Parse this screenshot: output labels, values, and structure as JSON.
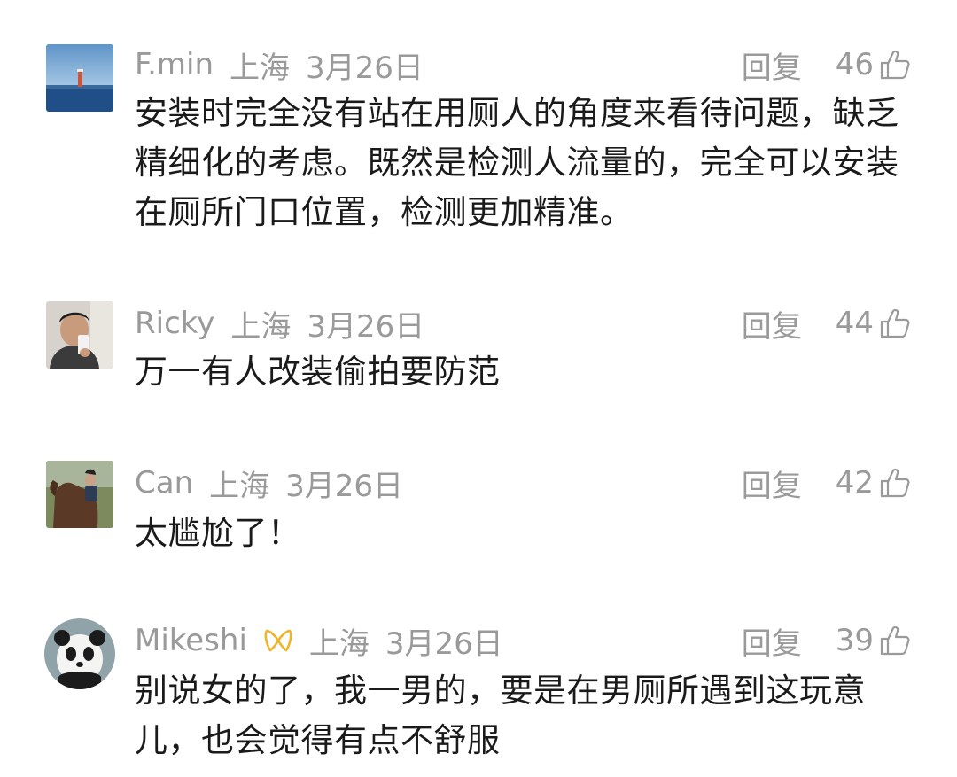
{
  "comments": [
    {
      "name": "F.min",
      "location": "上海",
      "date": "3月26日",
      "reply_label": "回复",
      "likes": "46",
      "text": "安装时完全没有站在用厕人的角度来看待问题，缺乏精细化的考虑。既然是检测人流量的，完全可以安装在厕所门口位置，检测更加精准。",
      "avatar": "seascape-lighthouse"
    },
    {
      "name": "Ricky",
      "location": "上海",
      "date": "3月26日",
      "reply_label": "回复",
      "likes": "44",
      "text": "万一有人改装偷拍要防范",
      "avatar": "selfie-person"
    },
    {
      "name": "Can",
      "location": "上海",
      "date": "3月26日",
      "reply_label": "回复",
      "likes": "42",
      "text": "太尴尬了！",
      "avatar": "horse-rider"
    },
    {
      "name": "Mikeshi",
      "location": "上海",
      "date": "3月26日",
      "reply_label": "回复",
      "likes": "39",
      "text": "别说女的了，我一男的，要是在男厕所遇到这玩意儿，也会觉得有点不舒服",
      "avatar": "panda-toy",
      "badge": "ribbon-badge-icon"
    }
  ],
  "colors": {
    "meta_text": "#9a9a9a",
    "body_text": "#1a1a1a",
    "badge": "#f0b429",
    "background": "#ffffff"
  },
  "icons": {
    "like": "thumbs-up-icon"
  }
}
